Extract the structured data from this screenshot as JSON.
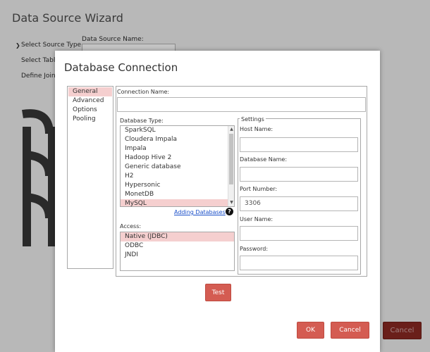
{
  "wizard": {
    "title": "Data Source Wizard",
    "steps": [
      {
        "label": "Select Source Type",
        "active": true
      },
      {
        "label": "Select Tables",
        "active": false
      },
      {
        "label": "Define Joins",
        "active": false
      }
    ],
    "data_source_name_label": "Data Source Name:",
    "cancel_label": "Cancel"
  },
  "dialog": {
    "title": "Database Connection",
    "nav": [
      {
        "label": "General",
        "selected": true
      },
      {
        "label": "Advanced",
        "selected": false
      },
      {
        "label": "Options",
        "selected": false
      },
      {
        "label": "Pooling",
        "selected": false
      }
    ],
    "connection_name_label": "Connection Name:",
    "connection_name_value": "",
    "database_type_label": "Database Type:",
    "database_types": [
      {
        "label": "SparkSQL",
        "selected": false
      },
      {
        "label": "Cloudera Impala",
        "selected": false
      },
      {
        "label": "Impala",
        "selected": false
      },
      {
        "label": "Hadoop Hive 2",
        "selected": false
      },
      {
        "label": "Generic database",
        "selected": false
      },
      {
        "label": "H2",
        "selected": false
      },
      {
        "label": "Hypersonic",
        "selected": false
      },
      {
        "label": "MonetDB",
        "selected": false
      },
      {
        "label": "MySQL",
        "selected": true
      }
    ],
    "adding_databases_link": "Adding Databases",
    "access_label": "Access:",
    "access_options": [
      {
        "label": "Native (JDBC)",
        "selected": true
      },
      {
        "label": "ODBC",
        "selected": false
      },
      {
        "label": "JNDI",
        "selected": false
      }
    ],
    "settings": {
      "legend": "Settings",
      "host_name_label": "Host Name:",
      "host_name_value": "",
      "database_name_label": "Database Name:",
      "database_name_value": "",
      "port_number_label": "Port Number:",
      "port_number_value": "3306",
      "user_name_label": "User Name:",
      "user_name_value": "",
      "password_label": "Password:",
      "password_value": ""
    },
    "test_label": "Test",
    "ok_label": "OK",
    "cancel_label": "Cancel"
  },
  "colors": {
    "accent": "#d45c52",
    "selection": "#f5cfcf",
    "link": "#1a4fc9"
  }
}
